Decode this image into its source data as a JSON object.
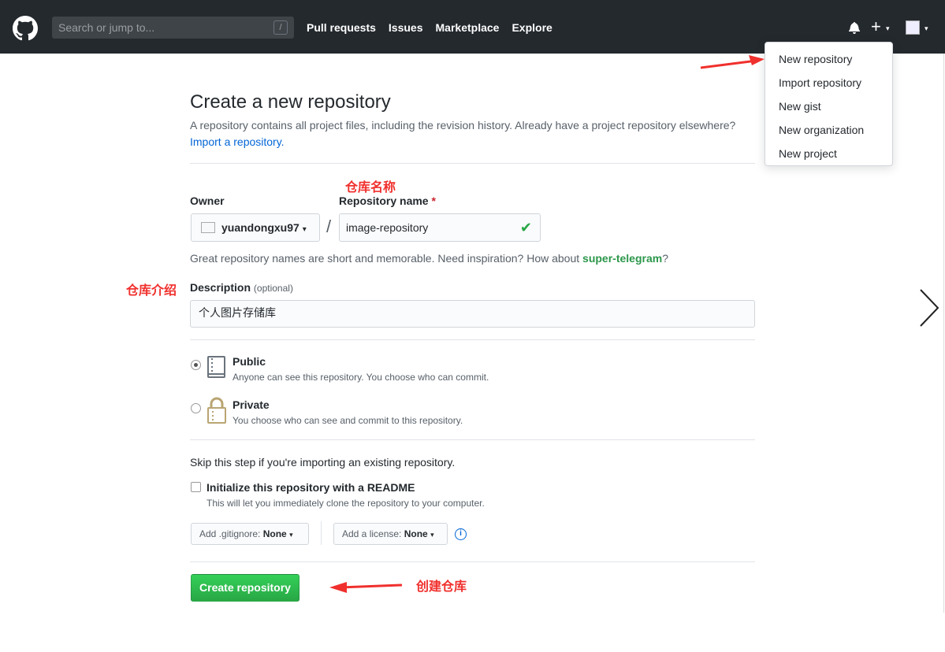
{
  "header": {
    "search_placeholder": "Search or jump to...",
    "search_shortcut": "/",
    "nav": [
      "Pull requests",
      "Issues",
      "Marketplace",
      "Explore"
    ],
    "plus_label": "+"
  },
  "dropdown": {
    "items": [
      "New repository",
      "Import repository",
      "New gist",
      "New organization",
      "New project"
    ]
  },
  "page": {
    "title": "Create a new repository",
    "lead": "A repository contains all project files, including the revision history. Already have a project repository elsewhere?",
    "import_link": "Import a repository.",
    "owner_label": "Owner",
    "repo_label": "Repository name",
    "required_mark": "*",
    "owner_value": "yuandongxu97",
    "separator": "/",
    "repo_value": "image-repository",
    "hint_prefix": "Great repository names are short and memorable. Need inspiration? How about ",
    "hint_name": "super-telegram",
    "hint_suffix": "?",
    "desc_label": "Description",
    "desc_optional": "(optional)",
    "desc_value": "个人图片存储库",
    "public_title": "Public",
    "public_sub": "Anyone can see this repository. You choose who can commit.",
    "private_title": "Private",
    "private_sub": "You choose who can see and commit to this repository.",
    "skip_text": "Skip this step if you're importing an existing repository.",
    "init_label": "Initialize this repository with a README",
    "init_sub": "This will let you immediately clone the repository to your computer.",
    "gitignore_prefix": "Add .gitignore:",
    "gitignore_value": "None",
    "license_prefix": "Add a license:",
    "license_value": "None",
    "info_glyph": "i",
    "create_label": "Create repository"
  },
  "annotations": {
    "repo_name": "仓库名称",
    "description": "仓库介绍",
    "create": "创建仓库"
  },
  "colors": {
    "header_bg": "#24292e",
    "create_button": "#28a745",
    "annotation": "#f0302d",
    "link": "#0366d6"
  }
}
